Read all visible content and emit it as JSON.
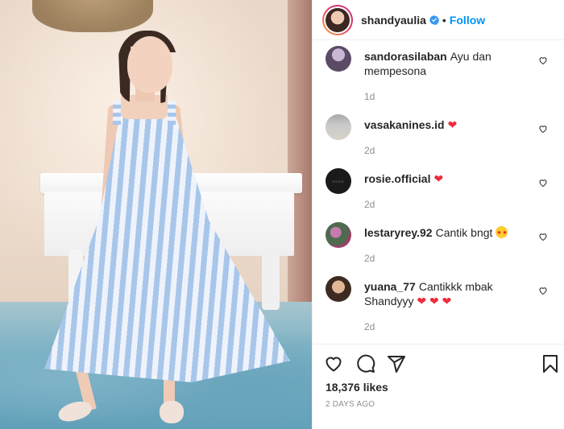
{
  "post": {
    "photo_alt": "Woman in a blue striped sundress spinning in front of a white grand piano"
  },
  "header": {
    "username": "shandyaulia",
    "separator": "•",
    "follow_label": "Follow"
  },
  "comments": [
    {
      "username": "sandorasilaban",
      "text": "Ayu dan mempesona",
      "hearts": 0,
      "time": "1d"
    },
    {
      "username": "vasakanines.id",
      "text": "",
      "hearts": 1,
      "time": "2d"
    },
    {
      "username": "rosie.official",
      "text": "",
      "hearts": 1,
      "time": "2d"
    },
    {
      "username": "lestaryrey.92",
      "text": "Cantik bngt",
      "emoji": "star-struck",
      "time": "2d"
    },
    {
      "username": "yuana_77",
      "text": "Cantikkk mbak Shandyyy",
      "hearts": 3,
      "time": "2d"
    }
  ],
  "heart_emoji": "❤",
  "rosie_avatar_text": "ROSIE",
  "likes_label": "18,376 likes",
  "time_ago": "2 DAYS AGO",
  "colors": {
    "follow_blue": "#0095f6",
    "text": "#262626",
    "muted": "#8e8e8e",
    "heart_red": "#ed2c3c"
  },
  "icons": [
    "verified-badge-icon",
    "heart-outline-icon",
    "comment-icon",
    "share-icon",
    "bookmark-icon"
  ]
}
